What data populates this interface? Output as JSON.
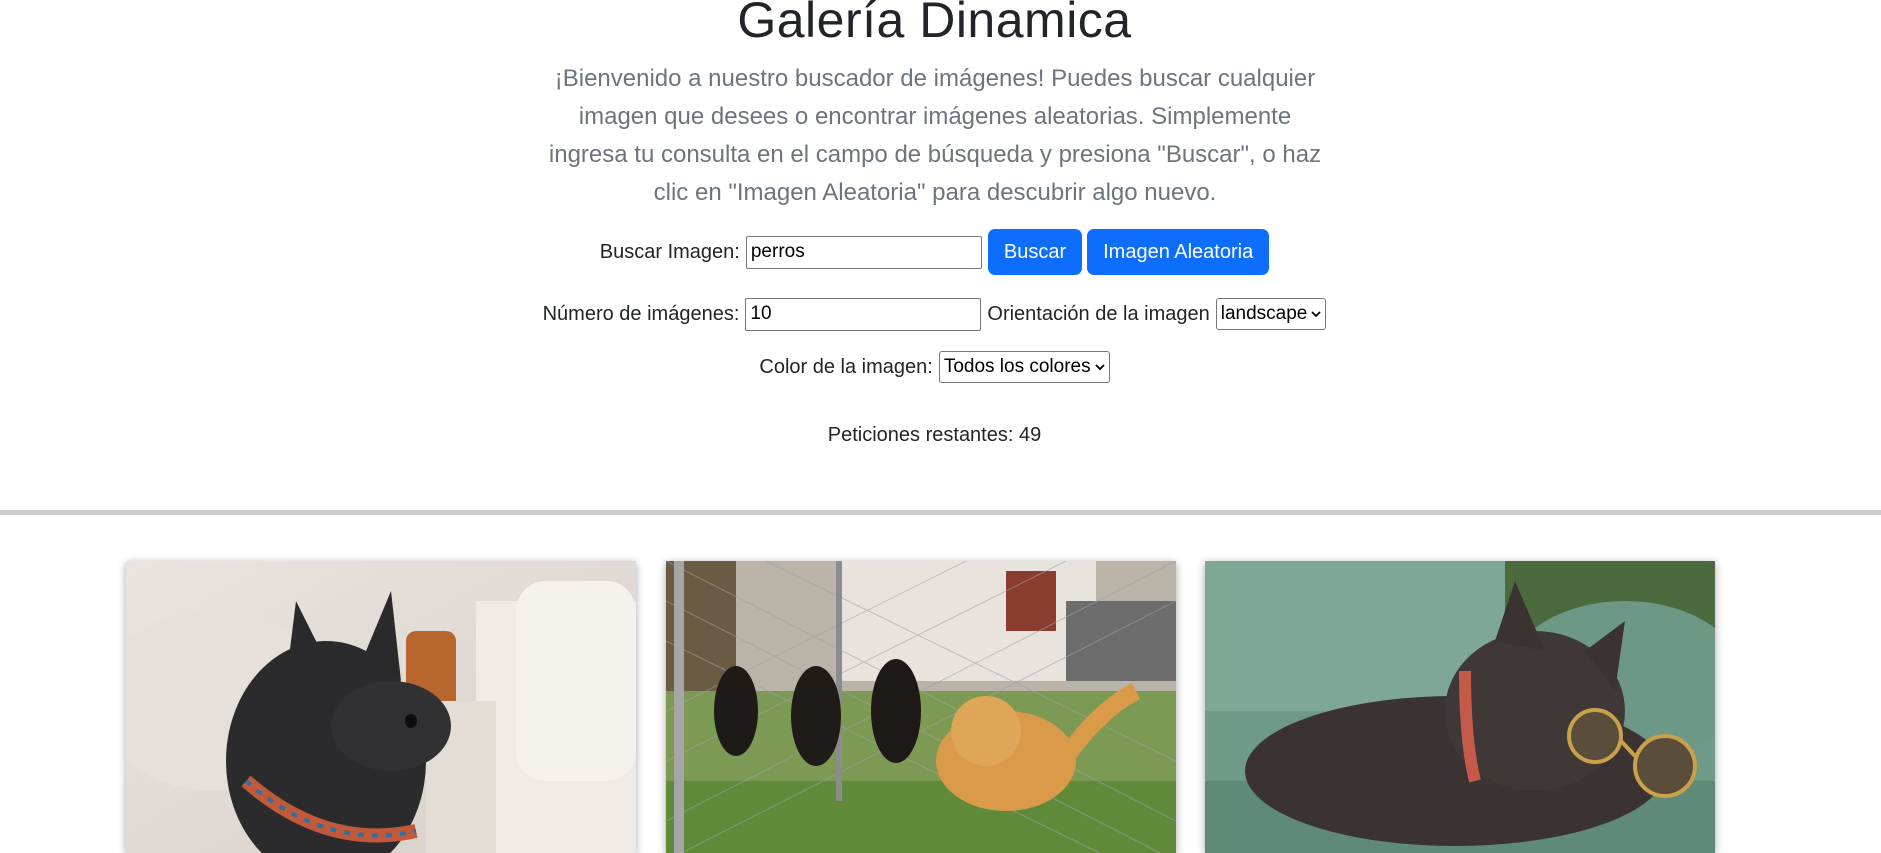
{
  "header": {
    "title": "Galería Dinamica",
    "intro": "¡Bienvenido a nuestro buscador de imágenes! Puedes buscar cualquier imagen que desees o encontrar imágenes aleatorias. Simplemente ingresa tu consulta en el campo de búsqueda y presiona \"Buscar\", o haz clic en \"Imagen Aleatoria\" para descubrir algo nuevo."
  },
  "search": {
    "label": "Buscar Imagen:",
    "value": "perros",
    "search_button": "Buscar",
    "random_button": "Imagen Aleatoria"
  },
  "options": {
    "count_label": "Número de imágenes:",
    "count_value": "10",
    "orientation_label": "Orientación de la imagen",
    "orientation_selected": "landscape",
    "color_label": "Color de la imagen:",
    "color_selected": "Todos los colores"
  },
  "status": {
    "remaining": "Peticiones restantes: 49"
  },
  "gallery": {
    "images": [
      {
        "subject": "french bulldog with patterned collar"
      },
      {
        "subject": "rottweiler puppies at fence with golden retriever"
      },
      {
        "subject": "french bulldog wearing sunglasses on green sofa"
      }
    ]
  },
  "colors": {
    "primary": "#0d6efd",
    "muted_text": "#6c757d",
    "divider": "#cfcfcf"
  }
}
